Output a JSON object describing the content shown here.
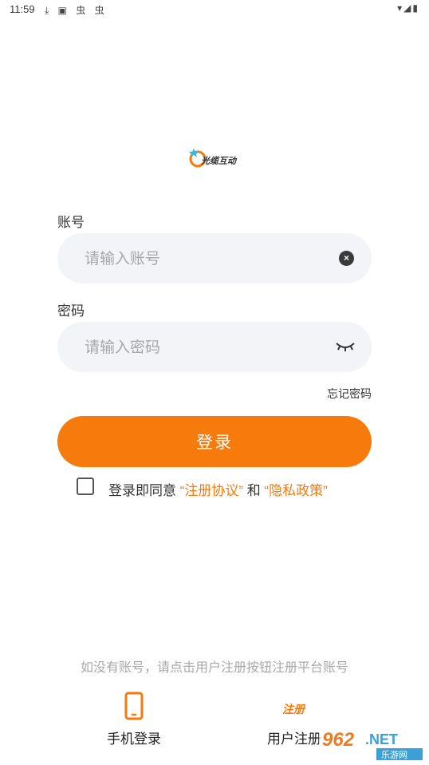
{
  "status_bar": {
    "time": "11:59",
    "left_icons": "⤓ ▣ 虫 虫",
    "right_icons": "▾◢▮"
  },
  "logo": {
    "brand_text": "光缆互动",
    "icon": "brand-logo-icon"
  },
  "form": {
    "account_label": "账号",
    "account_placeholder": "请输入账号",
    "account_value": "",
    "password_label": "密码",
    "password_placeholder": "请输入密码",
    "password_value": "",
    "forgot_password": "忘记密码",
    "login_button": "登录"
  },
  "agreement": {
    "checked": false,
    "prefix": "登录即同意 ",
    "terms_link": "“注册协议”",
    "conjunction": " 和 ",
    "privacy_link": "“隐私政策”"
  },
  "footer": {
    "hint": "如没有账号，请点击用户注册按钮注册平台账号",
    "phone_login": "手机登录",
    "register_icon_text": "注册",
    "user_register": "用户注册"
  },
  "watermark": {
    "brand": "962.NET",
    "sub": "乐游网"
  },
  "colors": {
    "accent": "#f77a0c",
    "field_bg": "#f3f4f8",
    "placeholder": "#a6a6ad"
  }
}
